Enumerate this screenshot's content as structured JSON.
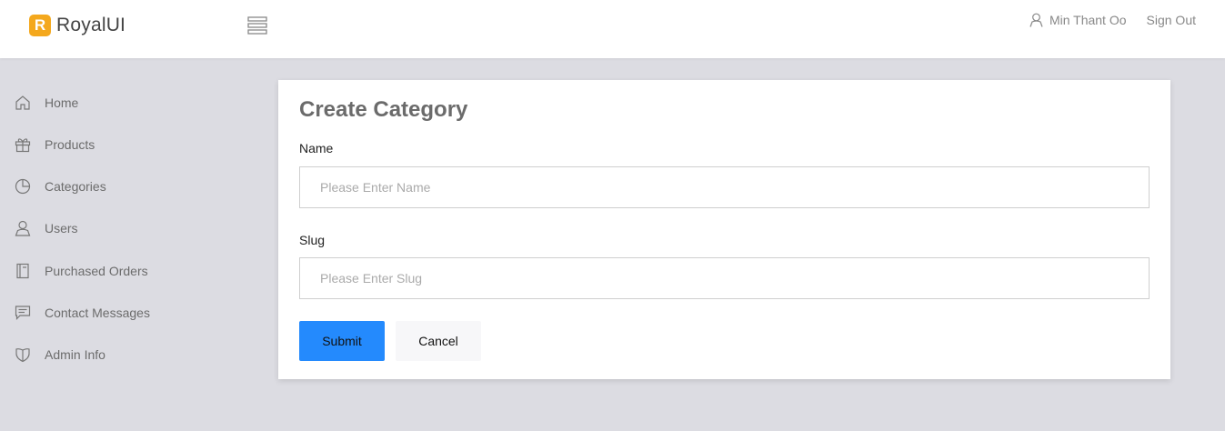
{
  "brand": {
    "logo_letter": "R",
    "name": "RoyalUI",
    "accent": "#f4a81d"
  },
  "header": {
    "user_name": "Min Thant Oo",
    "sign_out": "Sign Out"
  },
  "sidebar": {
    "items": [
      {
        "label": "Home",
        "icon": "home-icon"
      },
      {
        "label": "Products",
        "icon": "gift-icon"
      },
      {
        "label": "Categories",
        "icon": "pie-chart-icon"
      },
      {
        "label": "Users",
        "icon": "user-icon"
      },
      {
        "label": "Purchased Orders",
        "icon": "book-icon"
      },
      {
        "label": "Contact Messages",
        "icon": "message-icon"
      },
      {
        "label": "Admin Info",
        "icon": "shield-icon"
      }
    ]
  },
  "form": {
    "title": "Create Category",
    "name_label": "Name",
    "name_placeholder": "Please Enter Name",
    "name_value": "",
    "slug_label": "Slug",
    "slug_placeholder": "Please Enter Slug",
    "slug_value": "",
    "submit_label": "Submit",
    "cancel_label": "Cancel"
  },
  "colors": {
    "primary": "#248afd",
    "background": "#dcdce2"
  }
}
